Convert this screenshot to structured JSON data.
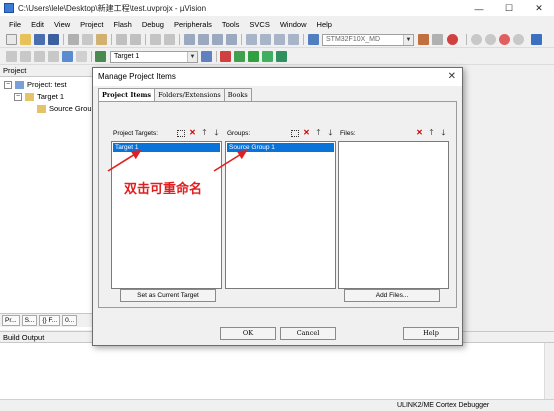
{
  "window": {
    "title": "C:\\Users\\lele\\Desktop\\新建工程\\test.uvprojx - µVision",
    "minimize": "—",
    "maximize": "☐",
    "close": "✕"
  },
  "menu": [
    "File",
    "Edit",
    "View",
    "Project",
    "Flash",
    "Debug",
    "Peripherals",
    "Tools",
    "SVCS",
    "Window",
    "Help"
  ],
  "toolbar": {
    "device_combo": "STM32F10X_MD",
    "target_combo": "Target 1"
  },
  "project_panel": {
    "header": "Project",
    "root": "Project: test",
    "target": "Target 1",
    "group": "Source Group",
    "tabs": [
      "Pr...",
      "S...",
      "{} F...",
      "0..."
    ]
  },
  "build_output": {
    "header": "Build Output"
  },
  "status_bar": {
    "debugger": "ULINK2/ME Cortex Debugger"
  },
  "dialog": {
    "title": "Manage Project Items",
    "tabs": [
      "Project Items",
      "Folders/Extensions",
      "Books"
    ],
    "targets_label": "Project Targets:",
    "groups_label": "Groups:",
    "files_label": "Files:",
    "targets": [
      "Target 1"
    ],
    "groups": [
      "Source Group 1"
    ],
    "set_current_target": "Set as Current Target",
    "add_files": "Add Files...",
    "ok": "OK",
    "cancel": "Cancel",
    "help": "Help"
  },
  "annotation": {
    "text": "双击可重命名",
    "color": "#e02020"
  },
  "colors": {
    "selection": "#0a73d9",
    "annotation": "#e02020"
  }
}
